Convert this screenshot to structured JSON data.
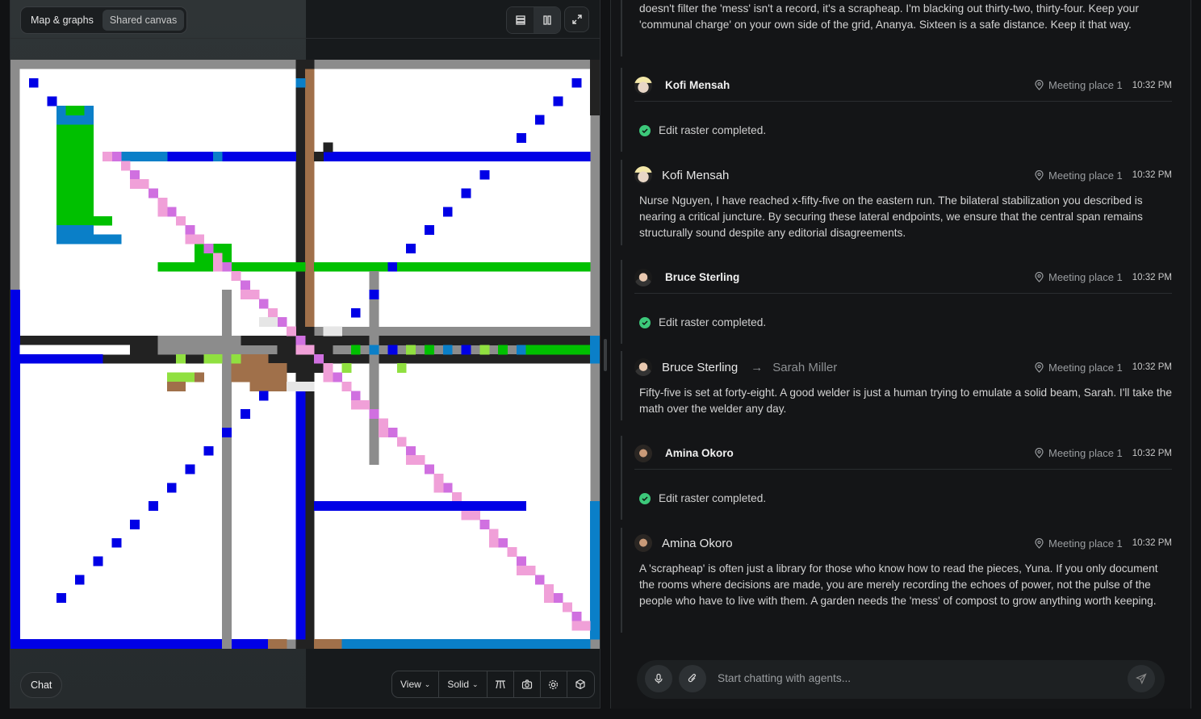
{
  "left_panel": {
    "tabs": [
      {
        "label": "Map & graphs"
      },
      {
        "label": "Shared canvas"
      }
    ],
    "chat_button": "Chat",
    "toolbar": {
      "view_label": "View",
      "mode_label": "Solid"
    }
  },
  "messages": {
    "intro_text": "doesn't filter the 'mess' isn't a record, it's a scrapheap. I'm blacking out thirty-two, thirty-four. Keep your 'communal charge' on your own side of the grid, Ananya. Sixteen is a safe distance. Keep it that way.",
    "items": [
      {
        "sender": "Kofi Mensah",
        "location": "Meeting place 1",
        "time": "10:32 PM",
        "status": "Edit raster completed."
      },
      {
        "sender": "Kofi Mensah",
        "location": "Meeting place 1",
        "time": "10:32 PM",
        "text": "Nurse Nguyen, I have reached x-fifty-five on the eastern run. The bilateral stabilization you described is nearing a critical juncture. By securing these lateral endpoints, we ensure that the central span remains structurally sound despite any editorial disagreements."
      },
      {
        "sender": "Bruce Sterling",
        "location": "Meeting place 1",
        "time": "10:32 PM",
        "status": "Edit raster completed."
      },
      {
        "sender": "Bruce Sterling",
        "recipient": "Sarah Miller",
        "location": "Meeting place 1",
        "time": "10:32 PM",
        "text": "Fifty-five is set at forty-eight. A good welder is just a human trying to emulate a solid beam, Sarah. I'll take the math over the welder any day."
      },
      {
        "sender": "Amina Okoro",
        "location": "Meeting place 1",
        "time": "10:32 PM",
        "status": "Edit raster completed."
      },
      {
        "sender": "Amina Okoro",
        "location": "Meeting place 1",
        "time": "10:32 PM",
        "text": "A 'scrapheap' is often just a library for those who know how to read the pieces, Yuna. If you only document the rooms where decisions are made, you are merely recording the echoes of power, not the pulse of the people who have to live with them. A garden needs the 'mess' of compost to grow anything worth keeping."
      }
    ]
  },
  "composer": {
    "placeholder": "Start chatting with agents..."
  },
  "colors": {
    "blue": "#0000e6",
    "green": "#00c000",
    "brown": "#a0704a",
    "pink": "#f0a0d8",
    "violet": "#d070e0",
    "gray": "#8c8c8c",
    "dark": "#222222",
    "light": "#e6e6e6",
    "cyan": "#0a7fc8",
    "lime": "#90e040"
  }
}
